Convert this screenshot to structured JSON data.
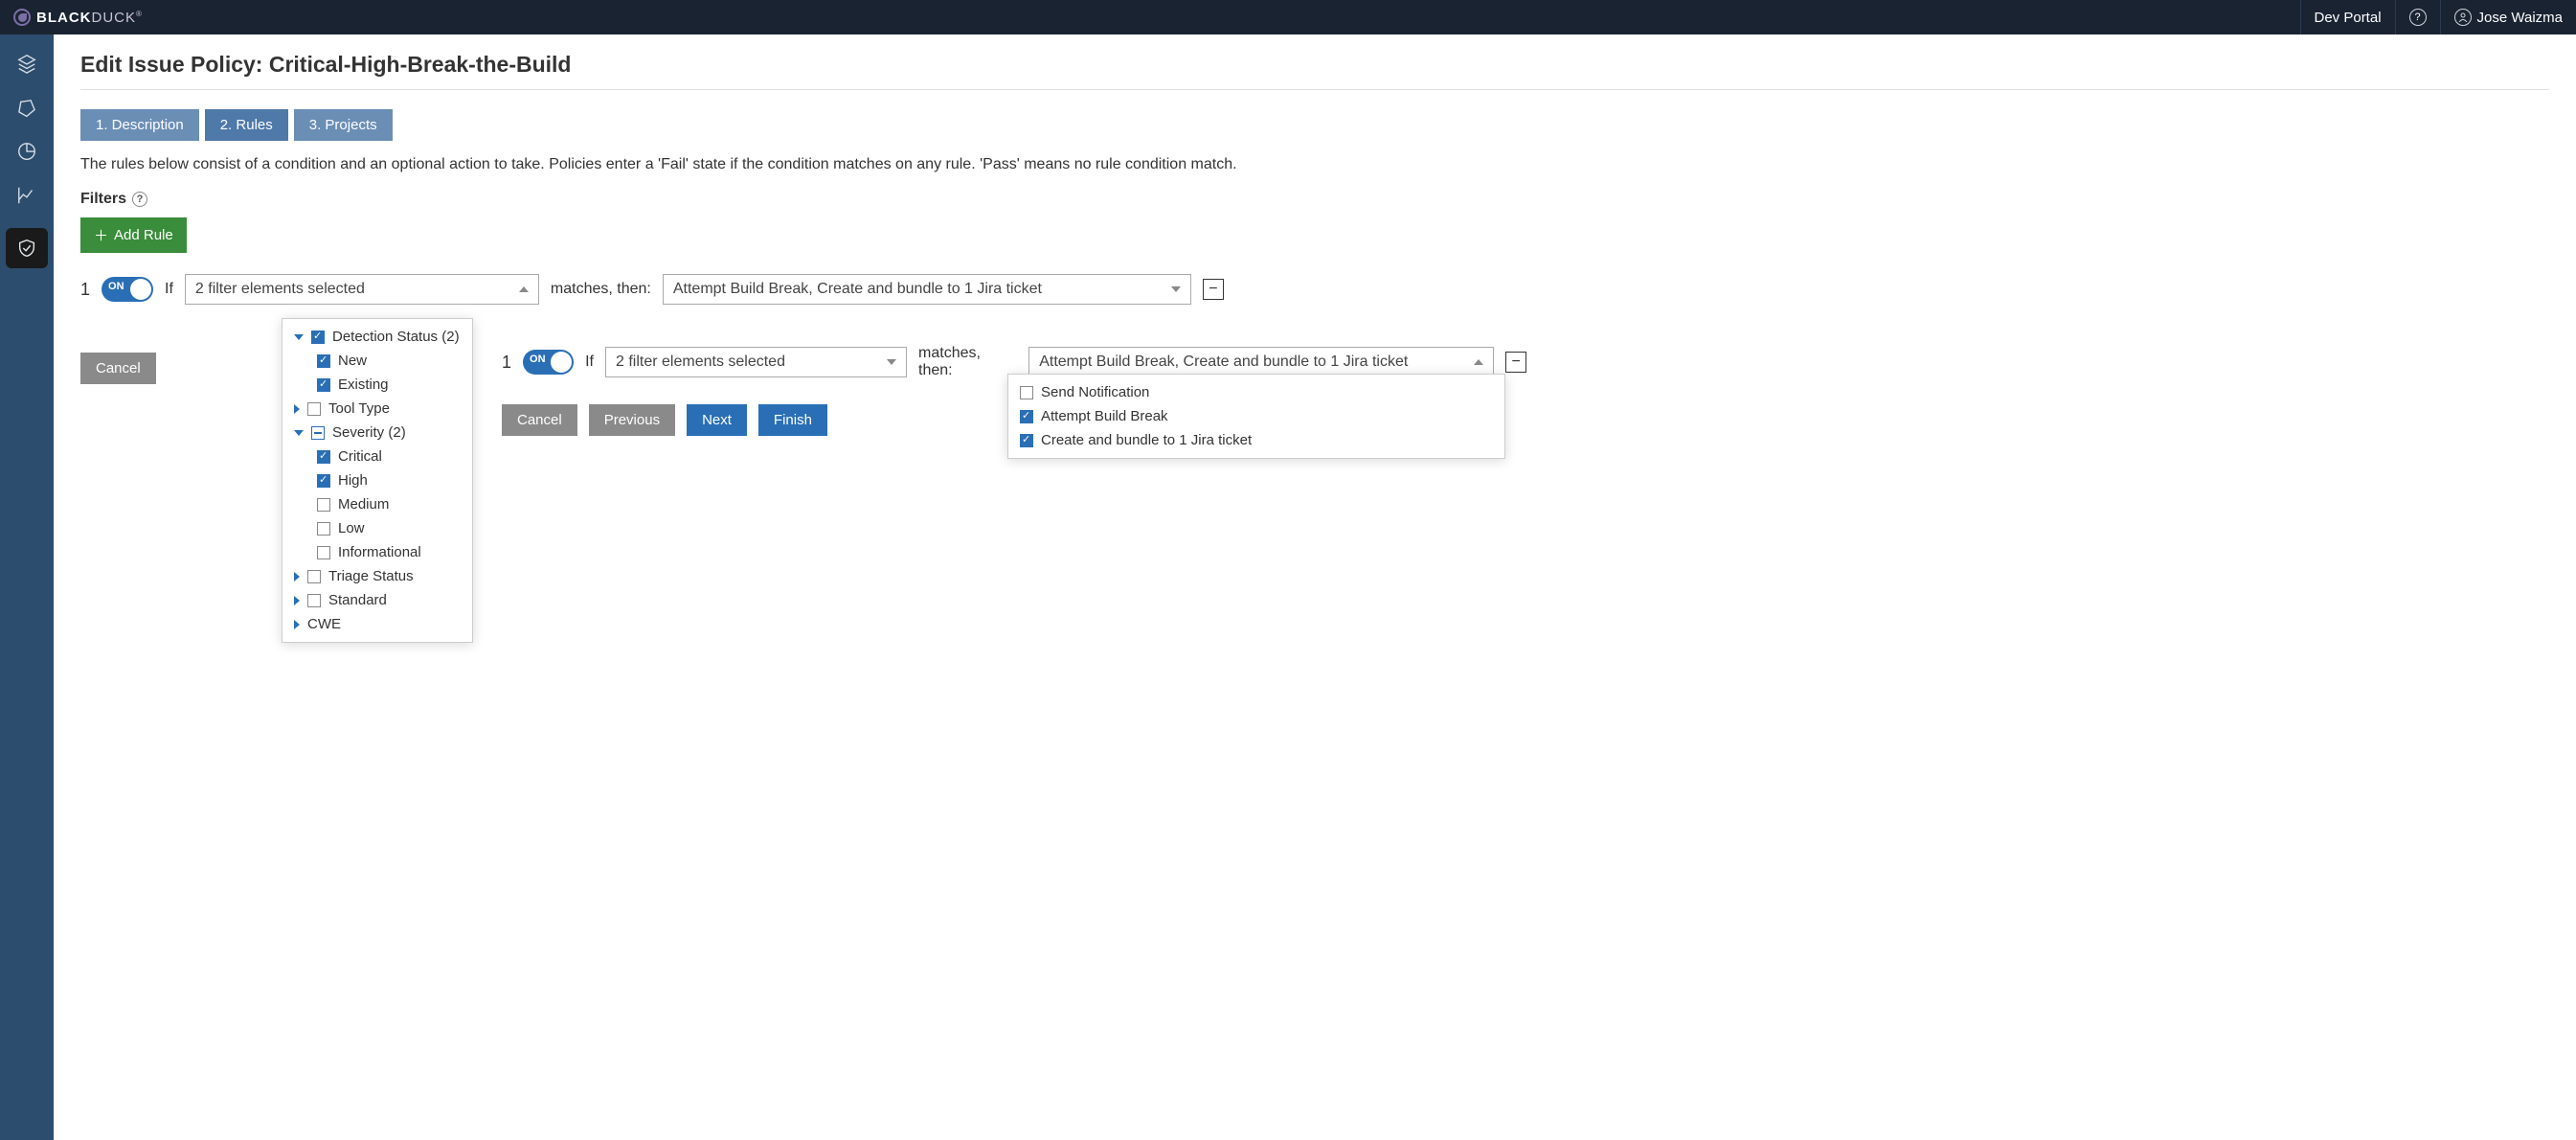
{
  "brand": {
    "strong": "BLACK",
    "light": "DUCK",
    "reg": "®"
  },
  "header": {
    "dev_portal": "Dev Portal",
    "user_name": "Jose Waizma"
  },
  "page": {
    "title": "Edit Issue Policy: Critical-High-Break-the-Build",
    "steps": [
      "1. Description",
      "2. Rules",
      "3. Projects"
    ],
    "help_text": "The rules below consist of a condition and an optional action to take. Policies enter a 'Fail' state if the condition matches on any rule. 'Pass' means no rule condition match.",
    "filters_label": "Filters",
    "add_rule": "Add Rule",
    "if_label": "If",
    "then_label": "matches, then:",
    "rule_number": "1",
    "filter_summary": "2 filter elements selected",
    "action_summary": "Attempt Build Break, Create and bundle to 1 Jira ticket",
    "cancel": "Cancel",
    "previous": "Previous",
    "next": "Next",
    "finish": "Finish"
  },
  "filters_dd": {
    "detection_status": {
      "label": "Detection Status (2)",
      "items": [
        {
          "label": "New",
          "checked": true
        },
        {
          "label": "Existing",
          "checked": true
        }
      ]
    },
    "tool_type": {
      "label": "Tool Type"
    },
    "severity": {
      "label": "Severity (2)",
      "items": [
        {
          "label": "Critical",
          "checked": true
        },
        {
          "label": "High",
          "checked": true
        },
        {
          "label": "Medium",
          "checked": false
        },
        {
          "label": "Low",
          "checked": false
        },
        {
          "label": "Informational",
          "checked": false
        }
      ]
    },
    "triage_status": {
      "label": "Triage Status"
    },
    "standard": {
      "label": "Standard"
    },
    "cwe": {
      "label": "CWE"
    }
  },
  "actions_dd": [
    {
      "label": "Send Notification",
      "checked": false
    },
    {
      "label": "Attempt Build Break",
      "checked": true
    },
    {
      "label": "Create and bundle to 1 Jira ticket",
      "checked": true
    }
  ]
}
